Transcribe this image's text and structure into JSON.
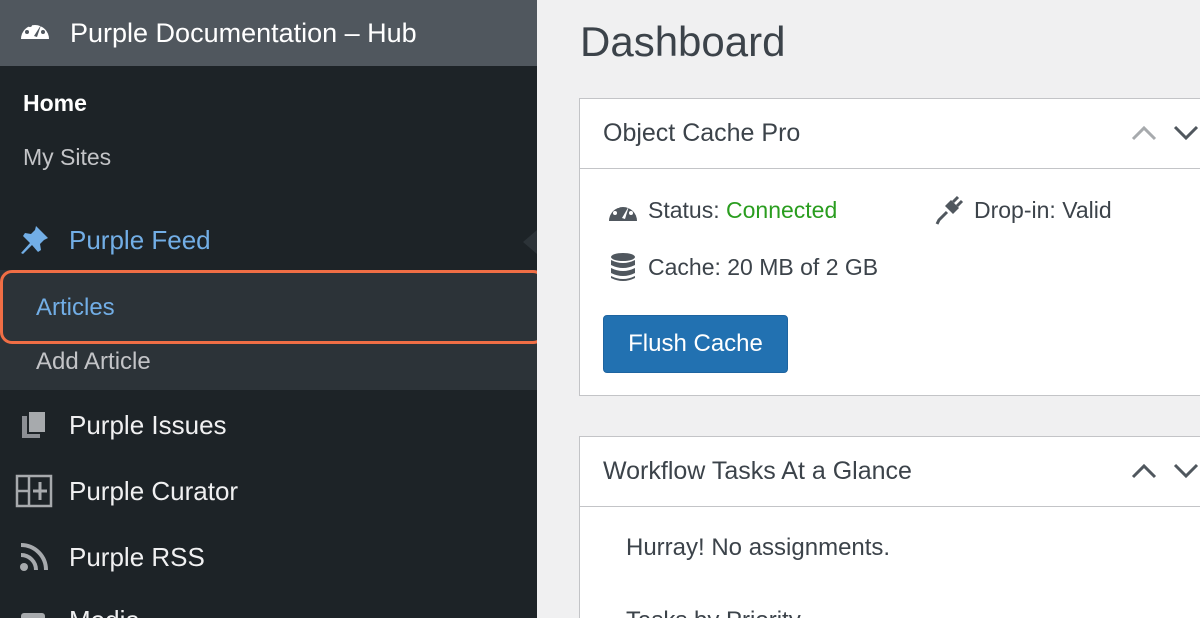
{
  "site": {
    "title": "Purple Documentation – Hub",
    "icon": "dashboard-gauge-icon"
  },
  "sidebar": {
    "home": "Home",
    "my_sites": "My Sites",
    "items": [
      {
        "label": "Purple Feed",
        "icon": "pushpin-icon",
        "current": true
      },
      {
        "label": "Purple Issues",
        "icon": "pages-icon"
      },
      {
        "label": "Purple Curator",
        "icon": "grid-plus-icon"
      },
      {
        "label": "Purple RSS",
        "icon": "rss-icon"
      },
      {
        "label": "Media",
        "icon": "media-icon"
      }
    ],
    "submenu": [
      {
        "label": "Articles",
        "active": true
      },
      {
        "label": "Add Article"
      }
    ],
    "highlight_color": "#f06e45",
    "accent_color": "#72aee6"
  },
  "main": {
    "page_title": "Dashboard",
    "cache_box": {
      "title": "Object Cache Pro",
      "status_label": "Status:",
      "status_value": "Connected",
      "dropin": "Drop-in: Valid",
      "cache": "Cache: 20 MB of 2 GB",
      "flush_button": "Flush Cache",
      "status_color": "#2a9d1f",
      "button_color": "#2271b1"
    },
    "workflow_box": {
      "title": "Workflow Tasks At a Glance",
      "no_assignments": "Hurray! No assignments.",
      "tasks_by_priority": "Tasks by Priority"
    }
  }
}
